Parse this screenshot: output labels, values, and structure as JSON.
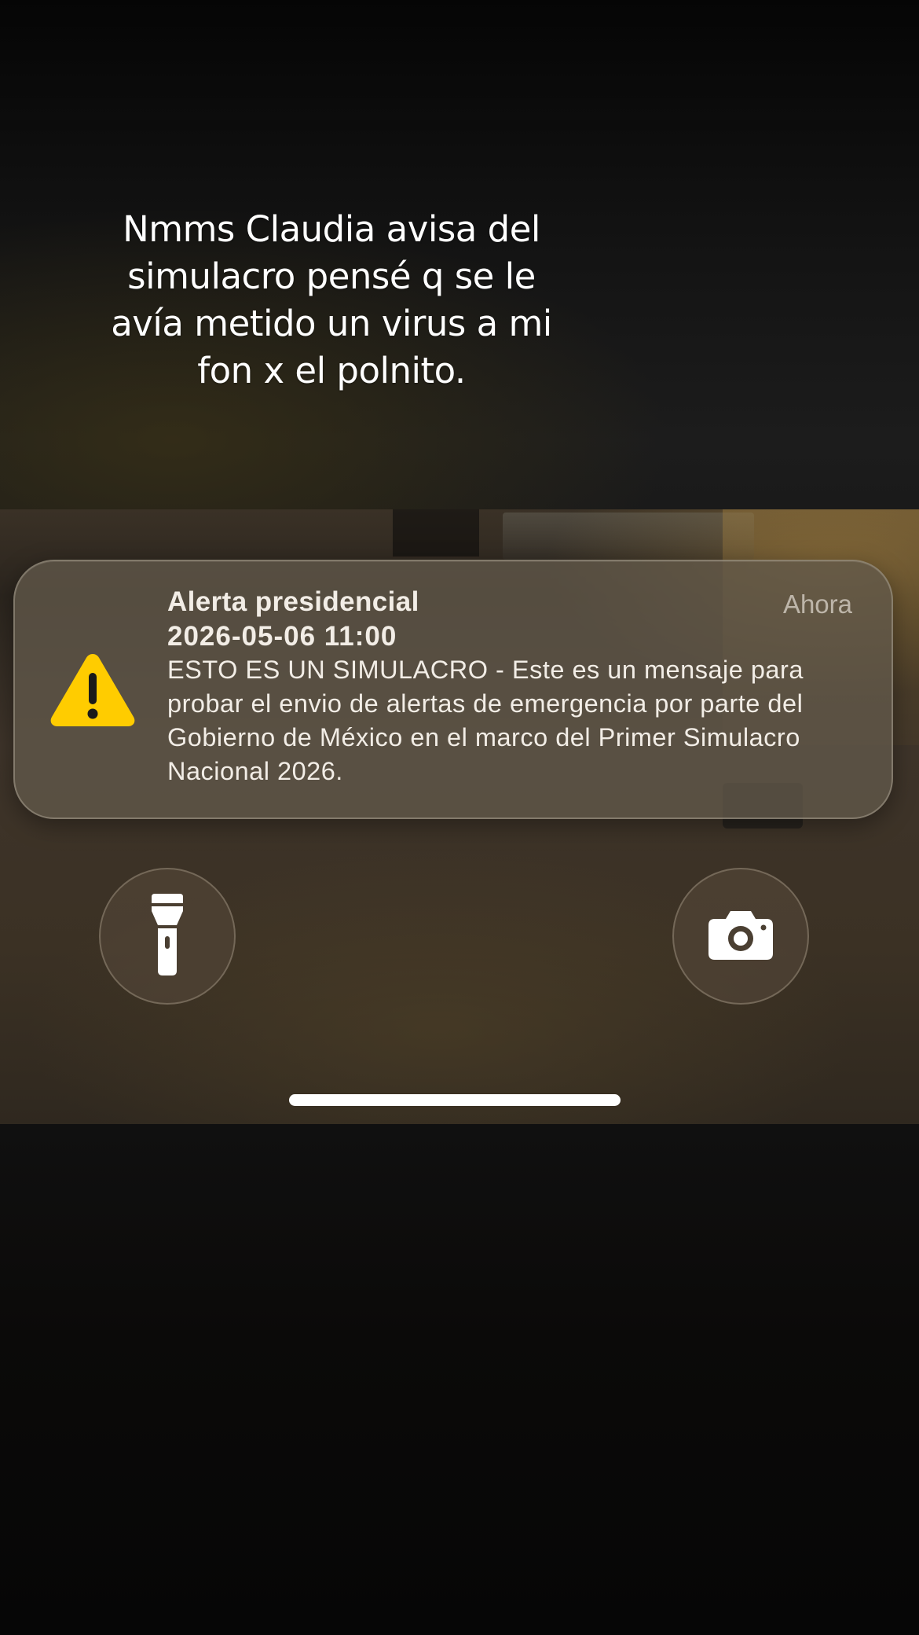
{
  "caption": {
    "text": "Nmms Claudia avisa del\nsimulacro pensé q se le\navía metido un virus a mi\nfon x el polnito."
  },
  "notification": {
    "title": "Alerta presidencial",
    "time": "Ahora",
    "datetime": "2026-05-06 11:00",
    "body": "ESTO ES UN SIMULACRO - Este es un mensaje para probar el envio de alertas de emergencia por parte del Gobierno de México en el marco del Primer Simulacro Nacional 2026.",
    "icon": "warning-triangle-icon",
    "icon_color": "#FFCC00"
  },
  "quick_actions": {
    "left_icon": "flashlight-icon",
    "right_icon": "camera-icon"
  },
  "colors": {
    "alert_yellow": "#FFCC00",
    "text_primary": "#F2EDE6"
  }
}
